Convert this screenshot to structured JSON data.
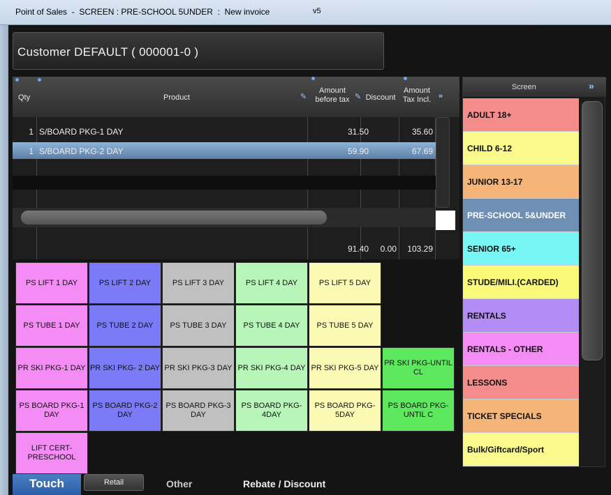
{
  "window": {
    "title": "Point of Sales  -  SCREEN : PRE-SCHOOL 5UNDER  :  New invoice",
    "version": "v5"
  },
  "customer": {
    "label": "Customer  DEFAULT  ( 000001-0 )"
  },
  "invoice": {
    "headers": {
      "qty": "Qty",
      "product": "Product",
      "amount_before_tax": "Amount before tax",
      "discount": "Discount",
      "amount_tax_incl": "Amount Tax Incl."
    },
    "rows": [
      {
        "qty": "1",
        "product": "S/BOARD PKG-1 DAY",
        "amount_before_tax": "31.50",
        "amount_tax_incl": "35.60"
      },
      {
        "qty": "1",
        "product": "S/BOARD PKG-2 DAY",
        "amount_before_tax": "59.90",
        "amount_tax_incl": "67.69"
      }
    ],
    "totals": {
      "amount_before_tax": "91.40",
      "discount": "0.00",
      "amount_tax_incl": "103.29"
    }
  },
  "products": [
    {
      "label": "PS LIFT 1 DAY",
      "color": "#f58cf5"
    },
    {
      "label": "PS LIFT 2 DAY",
      "color": "#7b7bf7"
    },
    {
      "label": "PS LIFT 3 DAY",
      "color": "#c0c0c0"
    },
    {
      "label": "PS LIFT 4 DAY",
      "color": "#b8f5b8"
    },
    {
      "label": "PS LIFT 5 DAY",
      "color": "#fafab4"
    },
    {
      "label": "PS TUBE 1 DAY",
      "color": "#f58cf5"
    },
    {
      "label": "PS TUBE 2 DAY",
      "color": "#7b7bf7"
    },
    {
      "label": "PS TUBE 3 DAY",
      "color": "#c0c0c0"
    },
    {
      "label": "PS TUBE 4 DAY",
      "color": "#b8f5b8"
    },
    {
      "label": "PS TUBE 5 DAY",
      "color": "#fafab4"
    },
    {
      "label": "PR SKI PKG-1 DAY",
      "color": "#f58cf5"
    },
    {
      "label": "PR SKI PKG- 2 DAY",
      "color": "#7b7bf7"
    },
    {
      "label": "PR SKI PKG-3 DAY",
      "color": "#c0c0c0"
    },
    {
      "label": "PR SKI PKG-4 DAY",
      "color": "#b8f5b8"
    },
    {
      "label": "PR SKI PKG-5 DAY",
      "color": "#fafab4"
    },
    {
      "label": "PR SKI PKG-UNTIL CL",
      "color": "#5ee85e"
    },
    {
      "label": "PS BOARD PKG-1 DAY",
      "color": "#f58cf5"
    },
    {
      "label": "PS BOARD PKG-2 DAY",
      "color": "#7b7bf7"
    },
    {
      "label": "PS BOARD PKG-3 DAY",
      "color": "#c0c0c0"
    },
    {
      "label": "PS BOARD PKG-4DAY",
      "color": "#b8f5b8"
    },
    {
      "label": "PS BOARD PKG-5DAY",
      "color": "#fafab4"
    },
    {
      "label": "PS BOARD PKG-UNTIL C",
      "color": "#5ee85e"
    },
    {
      "label": "LIFT CERT-PRESCHOOL",
      "color": "#f58cf5"
    }
  ],
  "screen": {
    "header": "Screen",
    "items": [
      {
        "label": "ADULT 18+",
        "color": "#f58c8c"
      },
      {
        "label": "CHILD 6-12",
        "color": "#fafa8c"
      },
      {
        "label": "JUNIOR  13-17",
        "color": "#f5b478"
      },
      {
        "label": "PRE-SCHOOL 5&UNDER",
        "color": "#6f8fb5"
      },
      {
        "label": "SENIOR 65+",
        "color": "#78f5f5"
      },
      {
        "label": "STUDE/MILI.(CARDED)",
        "color": "#fafa78"
      },
      {
        "label": "RENTALS",
        "color": "#b48cf5"
      },
      {
        "label": "RENTALS - OTHER",
        "color": "#f58cf5"
      },
      {
        "label": "LESSONS",
        "color": "#f58c8c"
      },
      {
        "label": "TICKET SPECIALS",
        "color": "#f5b478"
      },
      {
        "label": "Bulk/Giftcard/Sport",
        "color": "#fafa8c"
      }
    ]
  },
  "tabs": {
    "touch": "Touch",
    "retail": "Retail",
    "other": "Other",
    "rebate": "Rebate / Discount"
  }
}
